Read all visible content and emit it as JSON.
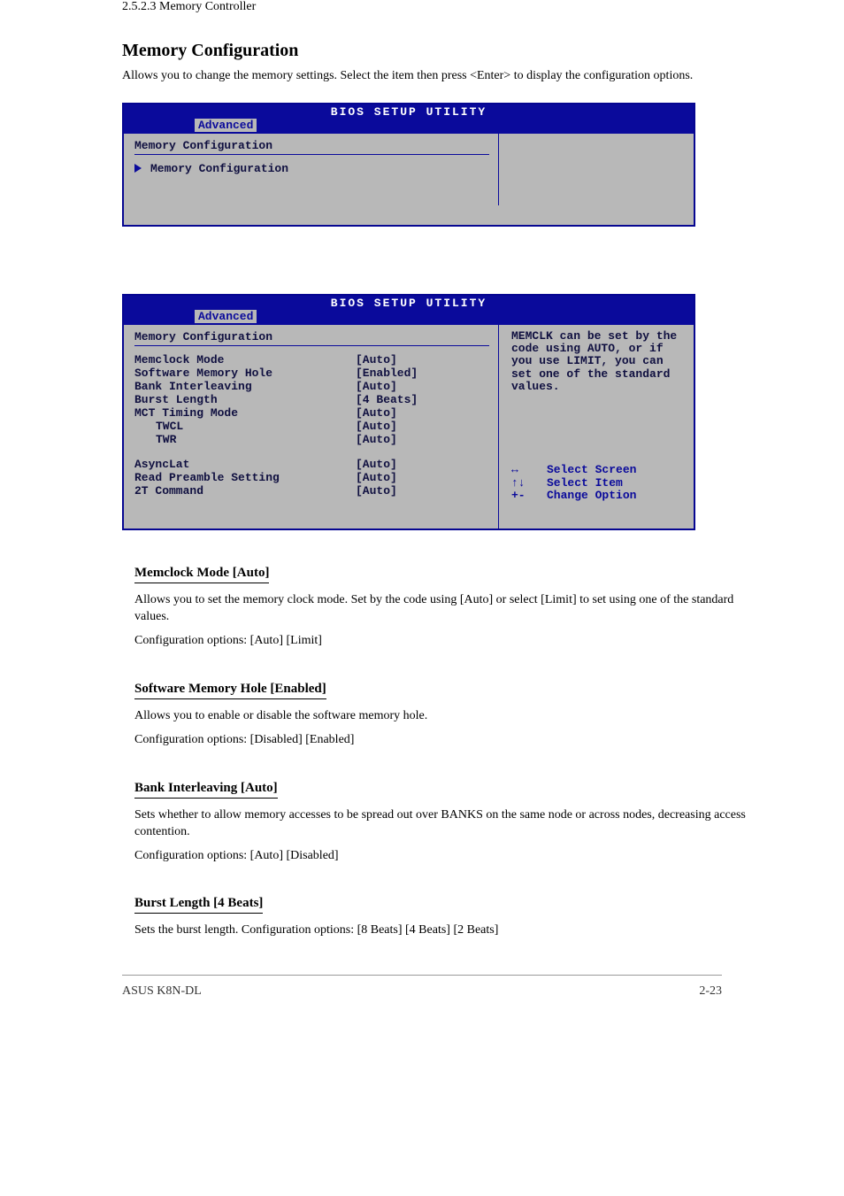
{
  "header": {
    "section_path": "2.5.2.3 Memory Controller",
    "section_title": "Memory Configuration",
    "section_body": "Allows you to change the memory settings. Select the item then press <Enter> to display the configuration options."
  },
  "bios1": {
    "title": "BIOS SETUP UTILITY",
    "tab": "Advanced",
    "section": "Memory Configuration",
    "submenu": "Memory Configuration"
  },
  "bios2": {
    "title": "BIOS SETUP UTILITY",
    "tab": "Advanced",
    "section": "Memory Configuration",
    "options": [
      {
        "label": "Memclock Mode",
        "value": "[Auto]"
      },
      {
        "label": "Software Memory Hole",
        "value": "[Enabled]"
      },
      {
        "label": "Bank Interleaving",
        "value": "[Auto]"
      },
      {
        "label": "Burst Length",
        "value": "[4 Beats]"
      },
      {
        "label": "MCT Timing Mode",
        "value": "[Auto]"
      },
      {
        "label": "TWCL",
        "value": "[Auto]",
        "indent": true
      },
      {
        "label": "TWR",
        "value": "[Auto]",
        "indent": true
      }
    ],
    "options2": [
      {
        "label": "AsyncLat",
        "value": "[Auto]"
      },
      {
        "label": "Read Preamble Setting",
        "value": "[Auto]"
      },
      {
        "label": "2T Command",
        "value": "[Auto]"
      }
    ],
    "help": "MEMCLK can be set by the code using AUTO, or if you use LIMIT, you can set one of the standard values.",
    "keys": [
      {
        "icon": "↔",
        "label": "Select Screen"
      },
      {
        "icon": "↑↓",
        "label": "Select Item"
      },
      {
        "icon": "+-",
        "label": "Change Option"
      }
    ]
  },
  "subs": [
    {
      "title": "Memclock Mode [Auto]",
      "body": "Allows you to set the memory clock mode. Set by the code using [Auto] or select [Limit] to set using one of the standard values.",
      "cfg": "Configuration options: [Auto] [Limit]"
    },
    {
      "title": "Software Memory Hole [Enabled]",
      "body": "Allows you to enable or disable the software memory hole.",
      "cfg": "Configuration options: [Disabled] [Enabled]"
    },
    {
      "title": "Bank Interleaving [Auto]",
      "body": "Sets whether to allow memory accesses to be spread out over BANKS on the same node or across nodes, decreasing access contention.",
      "cfg": "Configuration options: [Auto] [Disabled]"
    },
    {
      "title": "Burst Length [4 Beats]",
      "body": "Sets the burst length. Configuration options: [8 Beats] [4 Beats] [2 Beats]"
    }
  ],
  "footer": {
    "left": "ASUS K8N-DL",
    "right": "2-23"
  }
}
